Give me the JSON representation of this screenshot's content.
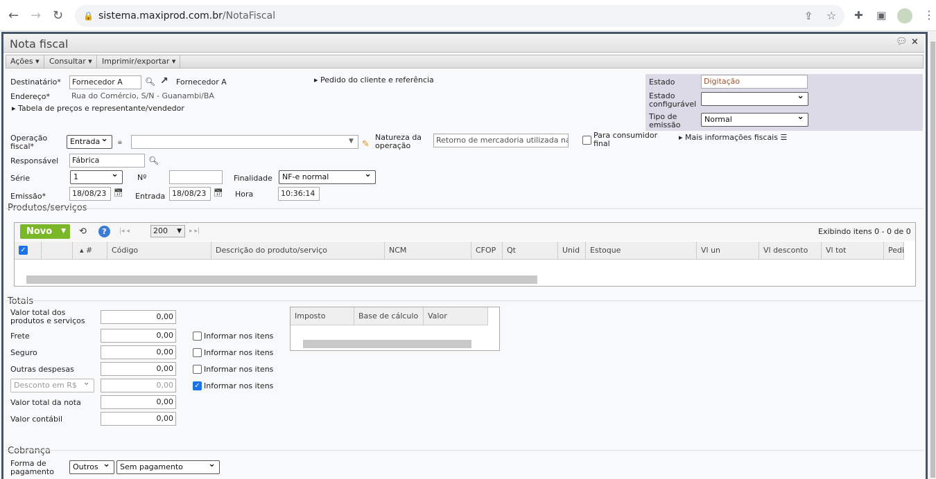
{
  "browser": {
    "url_host": "sistema.maxiprod.com.br",
    "url_path": "/NotaFiscal"
  },
  "window": {
    "title": "Nota fiscal"
  },
  "toolbar": [
    "Ações",
    "Consultar",
    "Imprimir/exportar"
  ],
  "header": {
    "destinatario_label": "Destinatário*",
    "destinatario_value": "Fornecedor A",
    "destinatario_link": "Fornecedor A",
    "endereco_label": "Endereço*",
    "endereco_value": "Rua do Comércio, S/N - Guanambi/BA",
    "tabela_link": "Tabela de preços e representante/vendedor",
    "pedido_link": "Pedido do cliente e referência",
    "estado_label": "Estado",
    "estado_value": "Digitação",
    "estado_config_label": "Estado configurável",
    "estado_config_value": "",
    "tipo_emissao_label": "Tipo de emissão",
    "tipo_emissao_value": "Normal",
    "operacao_label": "Operação fiscal*",
    "operacao_value": "Entrada",
    "operacao_select": "",
    "natureza_label": "Natureza da operação",
    "natureza_value": "Retorno de mercadoria utilizada na",
    "consumidor_label": "Para consumidor final",
    "mais_info": "Mais informações fiscais",
    "responsavel_label": "Responsável",
    "responsavel_value": "Fábrica",
    "serie_label": "Série",
    "serie_value": "1",
    "numero_label": "Nº",
    "numero_value": "",
    "finalidade_label": "Finalidade",
    "finalidade_value": "NF-e normal",
    "emissao_label": "Emissão*",
    "emissao_value": "18/08/23",
    "entrada_label": "Entrada",
    "entrada_value": "18/08/23",
    "hora_label": "Hora",
    "hora_value": "10:36:14"
  },
  "produtos": {
    "section": "Produtos/serviços",
    "novo": "Novo",
    "page_size": "200",
    "status": "Exibindo itens 0 - 0 de 0",
    "columns": [
      "#",
      "Código",
      "Descrição do produto/serviço",
      "NCM",
      "CFOP",
      "Qt",
      "Unid",
      "Estoque",
      "Vl un",
      "Vl desconto",
      "Vl tot",
      "Pedi"
    ]
  },
  "totais": {
    "section": "Totais",
    "rows": [
      {
        "label": "Valor total dos produtos e serviços",
        "value": "0,00"
      },
      {
        "label": "Frete",
        "value": "0,00",
        "check": "Informar nos itens"
      },
      {
        "label": "Seguro",
        "value": "0,00",
        "check": "Informar nos itens"
      },
      {
        "label": "Outras despesas",
        "value": "0,00",
        "check": "Informar nos itens"
      },
      {
        "label": "Desconto em R$",
        "value": "0,00",
        "check": "Informar nos itens"
      },
      {
        "label": "Valor total da nota",
        "value": "0,00"
      },
      {
        "label": "Valor contábil",
        "value": "0,00"
      }
    ],
    "impostos_columns": [
      "Imposto",
      "Base de cálculo",
      "Valor"
    ]
  },
  "cobranca": {
    "section": "Cobrança",
    "forma_label": "Forma de pagamento",
    "forma_value": "Outros",
    "condicao_value": "Sem pagamento"
  }
}
